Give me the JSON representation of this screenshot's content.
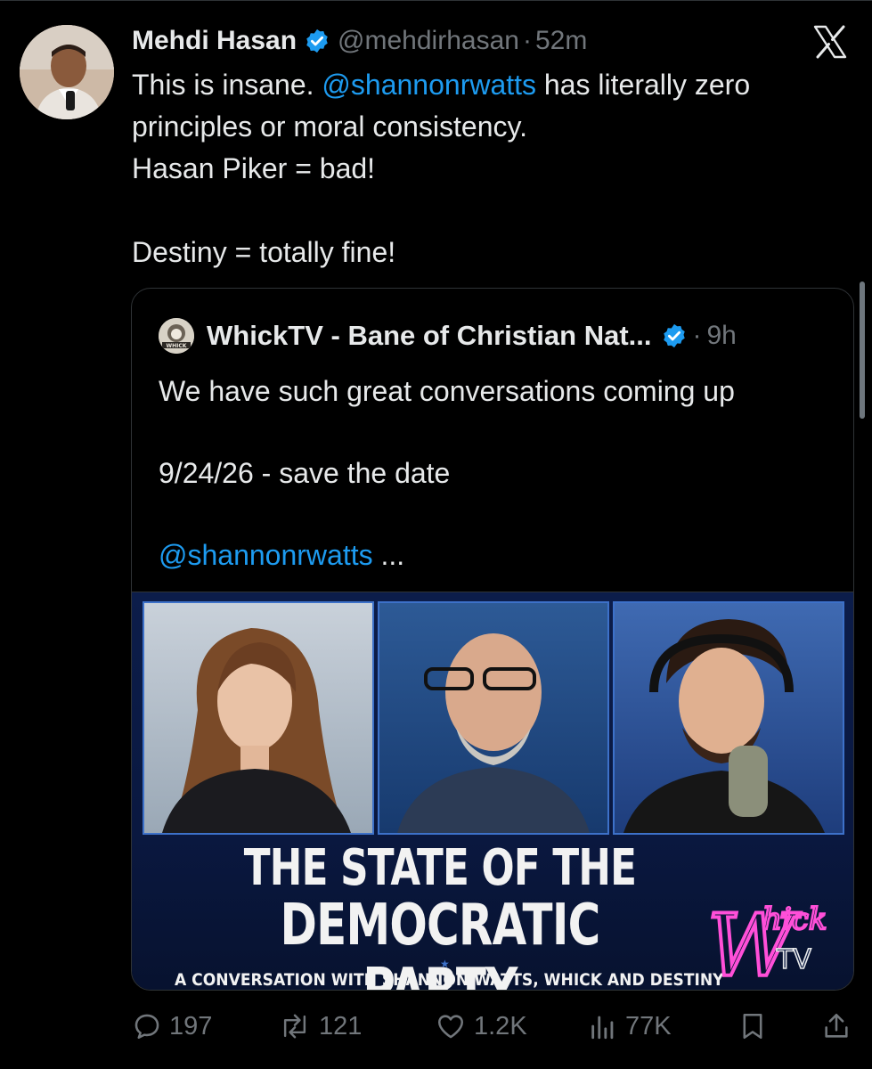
{
  "tweet": {
    "author_name": "Mehdi Hasan",
    "handle": "@mehdirhasan",
    "separator": "·",
    "time": "52m",
    "text_parts": {
      "l1_before": "This is insane. ",
      "l1_mention": "@shannonrwatts",
      "l1_after": " has literally zero",
      "l2": "principles or moral consistency.",
      "l3": "Hasan Piker = bad!",
      "l5": "Destiny = totally fine!"
    }
  },
  "quote": {
    "author_name": "WhickTV - Bane of Christian Nat...",
    "separator": "·",
    "time": "9h",
    "line1": "We have such great conversations coming up",
    "line3": "9/24/26 - save the date",
    "mention": "@shannonrwatts",
    "ellipsis": " ...",
    "avatar_text": "WHICK",
    "media": {
      "title_line1": "THE STATE OF THE",
      "title_line2": "DEMOCRATIC PARTY",
      "subtitle": "A CONVERSATION WITH SHANNON WATTS, WHICK AND DESTINY",
      "logo_text_main": "W",
      "logo_text_small": "hick",
      "logo_text_tv": "TV"
    }
  },
  "actions": {
    "replies": "197",
    "reposts": "121",
    "likes": "1.2K",
    "views": "77K"
  },
  "icons": [
    "verified-badge-icon",
    "x-logo-icon",
    "reply-icon",
    "repost-icon",
    "like-icon",
    "views-icon",
    "bookmark-icon",
    "share-icon"
  ],
  "colors": {
    "background": "#000000",
    "text": "#e7e9ea",
    "muted": "#71767b",
    "link": "#1d9bf0",
    "verified": "#1d9bf0",
    "neon_pink": "#ff4fd8"
  }
}
